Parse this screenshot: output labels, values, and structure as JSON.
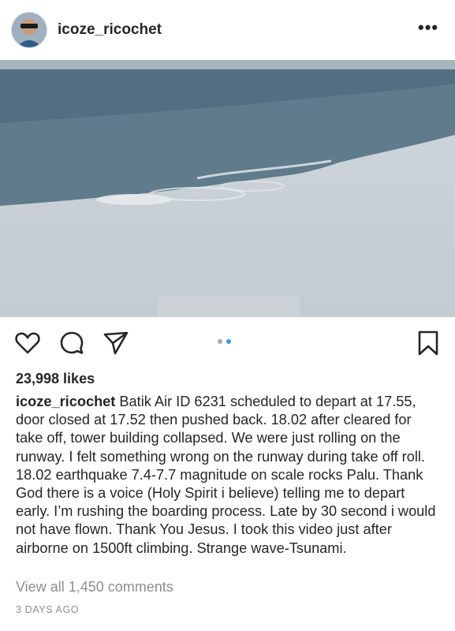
{
  "post": {
    "username": "icoze_ricochet",
    "more_label": "•••",
    "likes": "23,998 likes",
    "caption_username": "icoze_ricochet",
    "caption_text": "Batik Air ID 6231 scheduled to depart at 17.55, door closed at 17.52 then pushed back. 18.02 after cleared for take off, tower building collapsed. We were just rolling on the runway. I felt something wrong on the runway during take off roll. 18.02 earthquake 7.4-7.7 magnitude on scale rocks Palu. Thank God there is a voice (Holy Spirit i believe) telling me to depart early. I’m rushing the boarding process. Late by 30 second i would not have flown. Thank You Jesus. I took this video just after airborne on 1500ft climbing. Strange wave-Tsunami.",
    "view_comments": "View all 1,450 comments",
    "timestamp": "3 DAYS AGO"
  },
  "carousel": {
    "total": 2,
    "active_index": 1
  },
  "icons": {
    "like": "heart-icon",
    "comment": "comment-icon",
    "share": "send-icon",
    "save": "bookmark-icon",
    "more": "more-options-icon"
  },
  "colors": {
    "text": "#262626",
    "muted": "#8e8e8e",
    "active_dot": "#3897f0",
    "inactive_dot": "#a8a8a8"
  }
}
